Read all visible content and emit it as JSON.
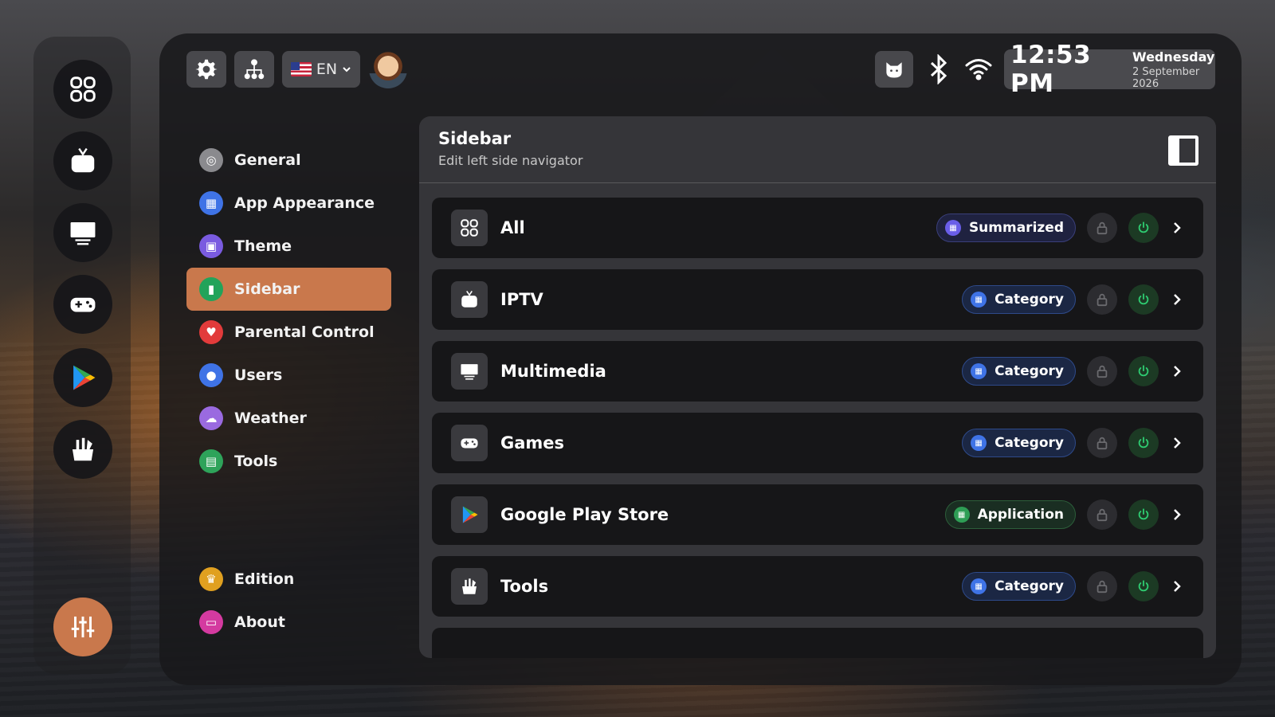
{
  "topbar": {
    "language": "EN",
    "time": "12:53 PM",
    "day": "Wednesday",
    "date": "2 September 2026"
  },
  "nav": {
    "items": [
      {
        "label": "General",
        "icon": "general-icon",
        "color": "#8a8a8e"
      },
      {
        "label": "App Appearance",
        "icon": "app-appearance-icon",
        "color": "#3f73e6"
      },
      {
        "label": "Theme",
        "icon": "theme-icon",
        "color": "#7a5be0"
      },
      {
        "label": "Sidebar",
        "icon": "sidebar-icon",
        "color": "#22a35a"
      },
      {
        "label": "Parental Control",
        "icon": "parental-control-icon",
        "color": "#e23b3b"
      },
      {
        "label": "Users",
        "icon": "users-icon",
        "color": "#3f73e6"
      },
      {
        "label": "Weather",
        "icon": "weather-icon",
        "color": "#9a6ae0"
      },
      {
        "label": "Tools",
        "icon": "tools-icon",
        "color": "#2ea35a"
      },
      {
        "label": "Edition",
        "icon": "crown-icon",
        "color": "#e0a020"
      },
      {
        "label": "About",
        "icon": "about-icon",
        "color": "#d43aa0"
      }
    ],
    "active": "Sidebar"
  },
  "content": {
    "title": "Sidebar",
    "subtitle": "Edit left side navigator",
    "rows": [
      {
        "label": "All",
        "badge": "Summarized",
        "type": "summ",
        "icon": "grid-icon"
      },
      {
        "label": "IPTV",
        "badge": "Category",
        "type": "cat",
        "icon": "tv-icon"
      },
      {
        "label": "Multimedia",
        "badge": "Category",
        "type": "cat",
        "icon": "monitor-icon"
      },
      {
        "label": "Games",
        "badge": "Category",
        "type": "cat",
        "icon": "gamepad-icon"
      },
      {
        "label": "Google Play Store",
        "badge": "Application",
        "type": "app",
        "icon": "play-store-icon"
      },
      {
        "label": "Tools",
        "badge": "Category",
        "type": "cat",
        "icon": "tools-icon"
      }
    ]
  },
  "colors": {
    "accent": "#c9784c",
    "power_green": "#2ecc71"
  }
}
